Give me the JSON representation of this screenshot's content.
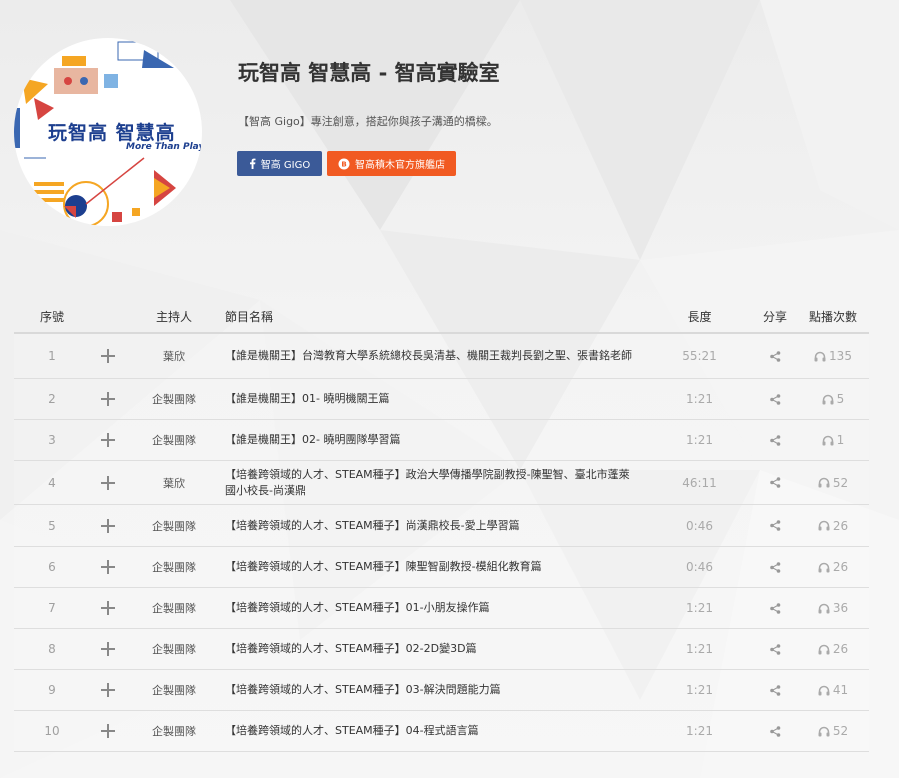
{
  "page": {
    "title": "玩智高 智慧高 - 智高實驗室",
    "description": "【智高 Gigo】專注創意，搭起你與孩子溝通的橋樑。"
  },
  "logo": {
    "text": "玩智高 智慧高",
    "subtitle": "More Than Play"
  },
  "buttons": {
    "facebook": {
      "label": "智高 GIGO",
      "icon": "facebook-icon",
      "color": "#3b5a98"
    },
    "shop": {
      "label": "智高積木官方旗艦店",
      "icon": "shop-icon",
      "color": "#f15a22"
    }
  },
  "table": {
    "headers": {
      "no": "序號",
      "host": "主持人",
      "title": "節目名稱",
      "length": "長度",
      "share": "分享",
      "plays": "點播次數"
    },
    "rows": [
      {
        "no": "1",
        "host": "葉欣",
        "title": "【誰是機關王】台灣教育大學系統總校長吳清基、機關王裁判長劉之聖、張書銘老師",
        "length": "55:21",
        "plays": "135"
      },
      {
        "no": "2",
        "host": "企製團隊",
        "title": "【誰是機關王】01- 曉明機關王篇",
        "length": "1:21",
        "plays": "5"
      },
      {
        "no": "3",
        "host": "企製團隊",
        "title": "【誰是機關王】02- 曉明團隊學習篇",
        "length": "1:21",
        "plays": "1"
      },
      {
        "no": "4",
        "host": "葉欣",
        "title": "【培養跨領域的人才、STEAM種子】政治大學傳播學院副教授-陳聖智、臺北市蓬萊國小校長-尚漢鼎",
        "length": "46:11",
        "plays": "52"
      },
      {
        "no": "5",
        "host": "企製團隊",
        "title": "【培養跨領域的人才、STEAM種子】尚漢鼎校長-愛上學習篇",
        "length": "0:46",
        "plays": "26"
      },
      {
        "no": "6",
        "host": "企製團隊",
        "title": "【培養跨領域的人才、STEAM種子】陳聖智副教授-模組化教育篇",
        "length": "0:46",
        "plays": "26"
      },
      {
        "no": "7",
        "host": "企製團隊",
        "title": "【培養跨領域的人才、STEAM種子】01-小朋友操作篇",
        "length": "1:21",
        "plays": "36"
      },
      {
        "no": "8",
        "host": "企製團隊",
        "title": "【培養跨領域的人才、STEAM種子】02-2D變3D篇",
        "length": "1:21",
        "plays": "26"
      },
      {
        "no": "9",
        "host": "企製團隊",
        "title": "【培養跨領域的人才、STEAM種子】03-解決問題能力篇",
        "length": "1:21",
        "plays": "41"
      },
      {
        "no": "10",
        "host": "企製團隊",
        "title": "【培養跨領域的人才、STEAM種子】04-程式語言篇",
        "length": "1:21",
        "plays": "52"
      }
    ]
  },
  "icons": {
    "add": "plus-icon",
    "share": "share-icon",
    "plays": "headphones-icon"
  },
  "colors": {
    "facebook": "#3b5a98",
    "shop": "#f15a22",
    "logo_blue": "#1d3f8f"
  }
}
